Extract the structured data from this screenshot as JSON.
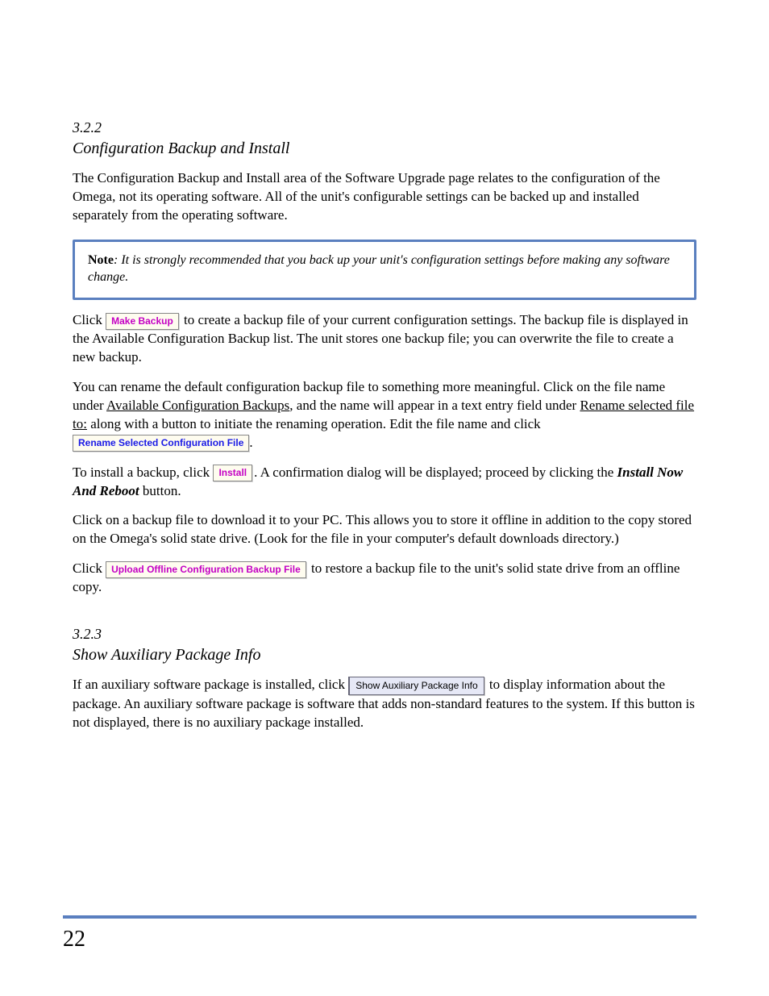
{
  "header": {
    "section_num": "3.2.2",
    "section_title": "Configuration Backup and Install"
  },
  "intro_text": "The Configuration Backup and Install area of the Software Upgrade page relates to the configuration of the Omega, not its operating software. All of the unit's configurable settings can be backed up and installed separately from the operating software.",
  "note": {
    "label": "Note",
    "text": ": It is strongly recommended that you back up your unit's configuration settings before making any software change."
  },
  "p1_a": "Click ",
  "btn_make_backup": "Make Backup",
  "p1_b": " to create a backup file of your current configuration settings. The backup file is displayed in the Available Configuration Backup list. The unit stores one backup file; you can overwrite the file to create a new backup.",
  "p2_a": "You can rename the default configuration backup file to something more meaningful. Click on the file name under ",
  "p2_u1": "Available Configuration Backups",
  "p2_b": ", and the name will appear in a text entry field under ",
  "p2_u2": "Rename selected file to:",
  "p2_c": " along with a button to initiate the renaming operation. Edit the file name and click ",
  "btn_rename": "Rename Selected Configuration File",
  "p2_d": ".",
  "p3_a": "To install a backup, click ",
  "btn_install": "Install",
  "p3_b": ". A confirmation dialog will be displayed; proceed by clicking the ",
  "p3_bold": "Install Now And Reboot",
  "p3_c": " button.",
  "p4": "Click on a backup file to download it to your PC. This allows you to store it offline in addition to the copy stored on the Omega's solid state drive. (Look for the file in your computer's default downloads directory.)",
  "p5_a": "Click ",
  "btn_upload": "Upload Offline Configuration Backup File",
  "p5_b": " to restore a backup file to the unit's solid state drive from an offline copy.",
  "aux_title": "Show Auxiliary Package Info",
  "aux_num": "3.2.3",
  "aux_p_a": "If an auxiliary software package is installed, click ",
  "btn_aux": "Show Auxiliary Package Info",
  "aux_p_b": " to display information about the package. An auxiliary software package is software that adds non-standard features to the system. If this button is not displayed, there is no auxiliary package installed.",
  "page_number": "22"
}
